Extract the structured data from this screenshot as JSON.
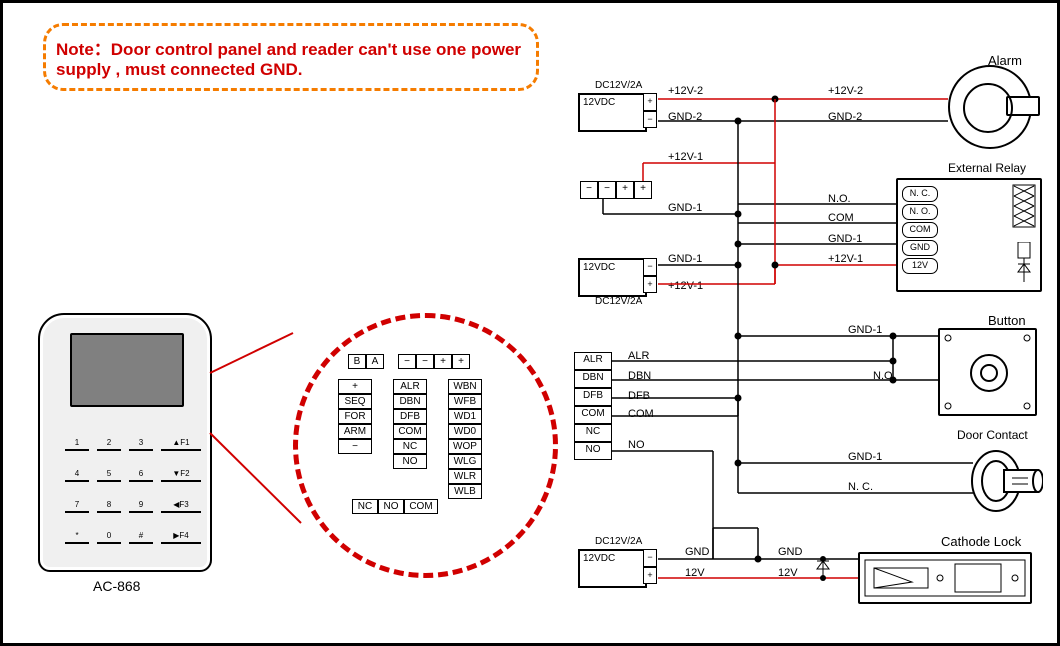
{
  "note": "Note：Door control panel and  reader can't use one power supply , must connected GND.",
  "controller_model": "AC-868",
  "keypad": {
    "r1": [
      "1",
      "2",
      "3",
      "▲F1"
    ],
    "r2": [
      "4",
      "5",
      "6",
      "▼F2"
    ],
    "r3": [
      "7",
      "8",
      "9",
      "◀F3"
    ],
    "r4": [
      "*",
      "0",
      "#",
      "▶F4"
    ]
  },
  "pcb": {
    "top1": [
      "B",
      "A"
    ],
    "top2": [
      "−",
      "−",
      "+",
      "+"
    ],
    "left_col": [
      "+",
      "SEQ",
      "FOR",
      "ARM",
      "−"
    ],
    "mid_col": [
      "ALR",
      "DBN",
      "DFB",
      "COM",
      "NC",
      "NO"
    ],
    "right_col": [
      "WBN",
      "WFB",
      "WD1",
      "WD0",
      "WOP",
      "WLG",
      "WLR",
      "WLB"
    ],
    "bottom": [
      "NC",
      "NO",
      "COM"
    ]
  },
  "psu_text": "12VDC",
  "psu_rating": "DC12V/2A",
  "devices": {
    "alarm": "Alarm",
    "relay": "External Relay",
    "button": "Button",
    "door_contact": "Door Contact",
    "cathode_lock": "Cathode Lock"
  },
  "relay_pins": [
    "N. C.",
    "N. O.",
    "COM",
    "GND",
    "12V"
  ],
  "left_block_terms": [
    "ALR",
    "DBN",
    "DFB",
    "COM",
    "NC",
    "NO"
  ],
  "misc_terms": [
    "−",
    "−",
    "+",
    "+"
  ],
  "wire_labels": {
    "p12v2": "+12V-2",
    "gnd2": "GND-2",
    "p12v1": "+12V-1",
    "gnd1": "GND-1",
    "no": "N.O.",
    "com": "COM",
    "nc": "N. C.",
    "alr": "ALR",
    "dbn": "DBN",
    "dfb": "DFB",
    "com2": "COM",
    "no2": "NO",
    "gnd": "GND",
    "v12": "12V"
  }
}
